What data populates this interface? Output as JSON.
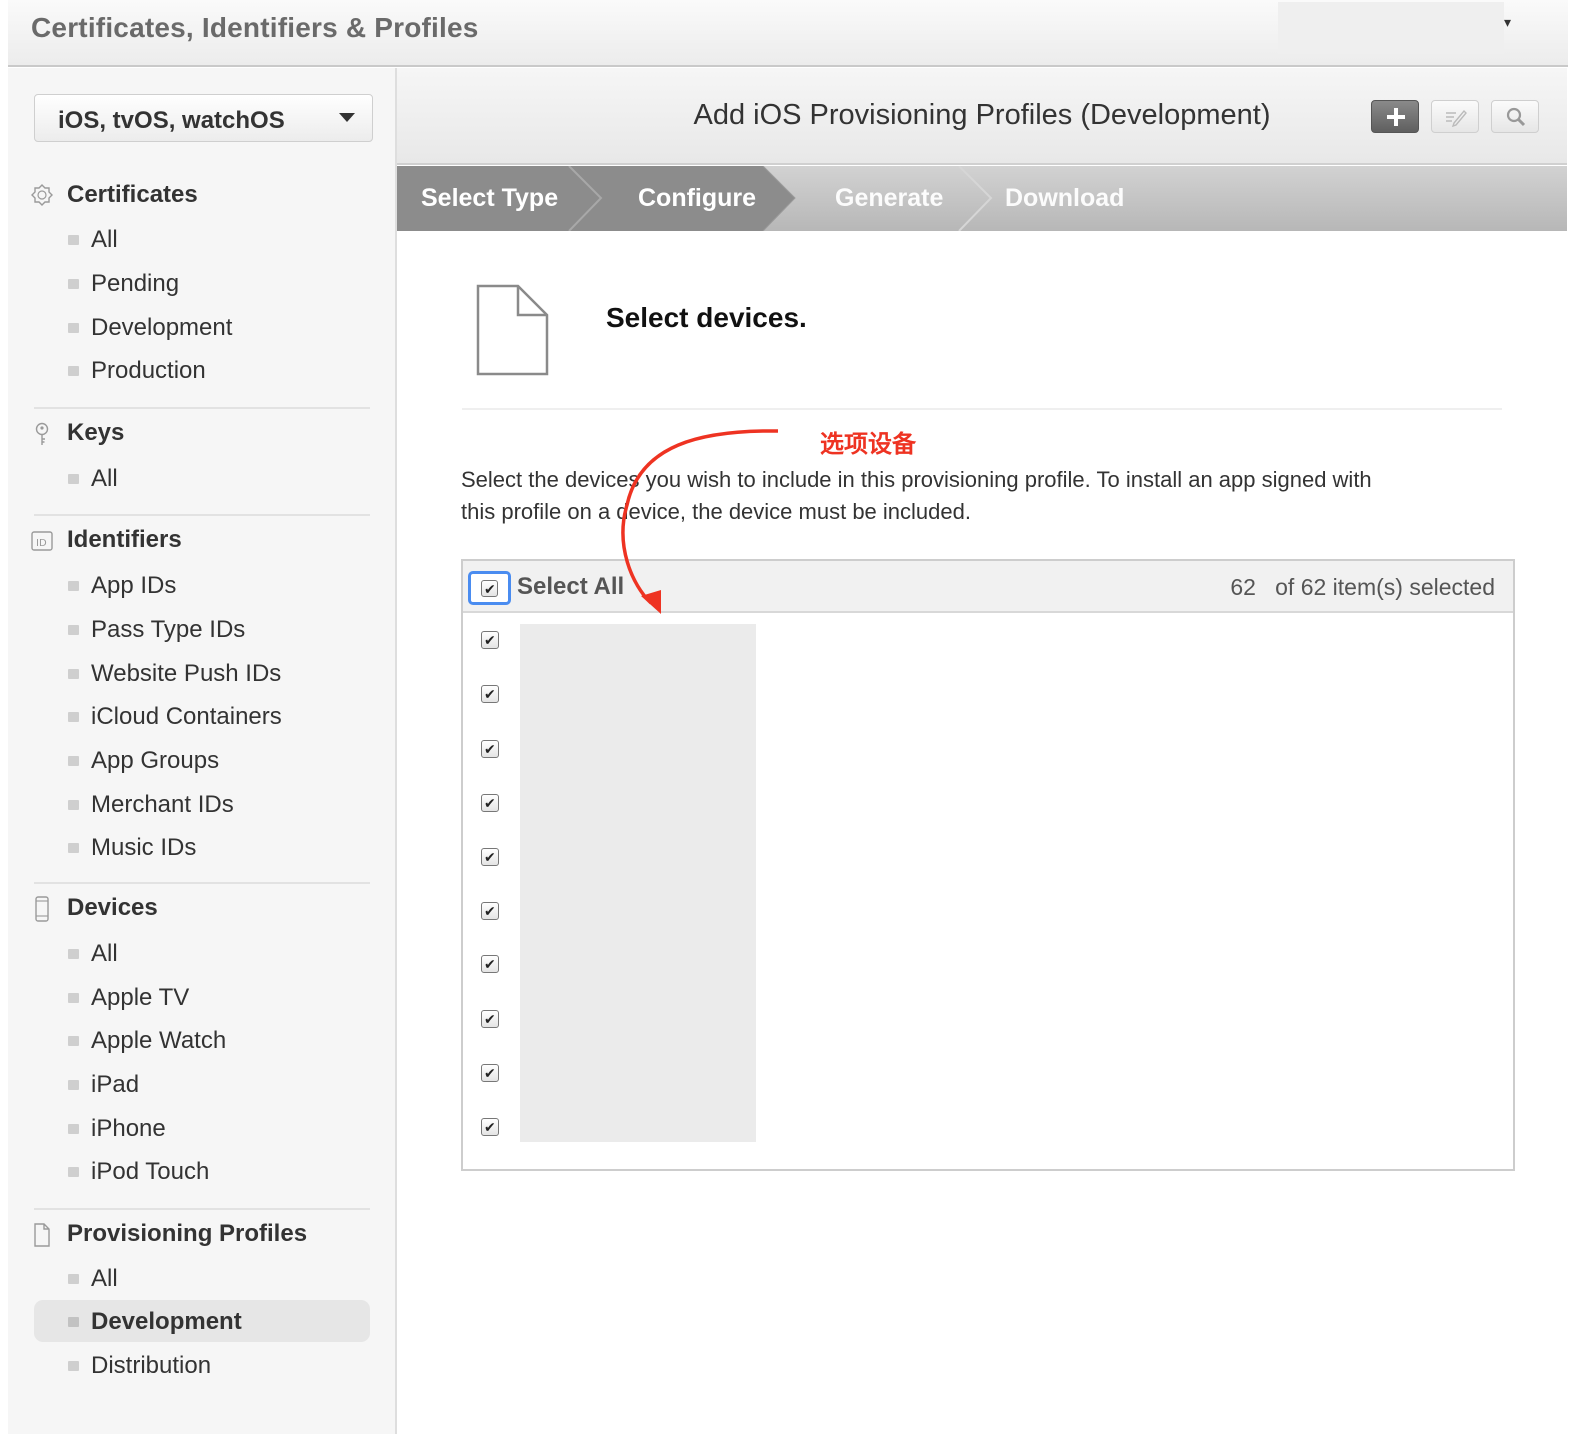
{
  "header": {
    "app_title": "Certificates, Identifiers & Profiles",
    "account_caret": "▾"
  },
  "sidebar": {
    "platform": "iOS, tvOS, watchOS",
    "sections": [
      {
        "title": "Certificates",
        "icon": "certificate-icon",
        "items": [
          "All",
          "Pending",
          "Development",
          "Production"
        ]
      },
      {
        "title": "Keys",
        "icon": "key-icon",
        "items": [
          "All"
        ]
      },
      {
        "title": "Identifiers",
        "icon": "id-badge-icon",
        "items": [
          "App IDs",
          "Pass Type IDs",
          "Website Push IDs",
          "iCloud Containers",
          "App Groups",
          "Merchant IDs",
          "Music IDs"
        ]
      },
      {
        "title": "Devices",
        "icon": "phone-icon",
        "items": [
          "All",
          "Apple TV",
          "Apple Watch",
          "iPad",
          "iPhone",
          "iPod Touch"
        ]
      },
      {
        "title": "Provisioning Profiles",
        "icon": "document-icon",
        "items": [
          "All",
          "Development",
          "Distribution"
        ]
      }
    ],
    "active_item": "Provisioning Profiles / Development"
  },
  "main": {
    "page_title": "Add iOS Provisioning Profiles (Development)",
    "toolbar": {
      "add": "add-icon",
      "edit": "edit-icon",
      "search": "search-icon"
    },
    "steps": [
      "Select Type",
      "Configure",
      "Generate",
      "Download"
    ],
    "current_step": "Configure",
    "step_heading": "Select devices.",
    "annotation": "选项设备",
    "instructions_line1": "Select the devices you wish to include in this provisioning profile. To install an app signed with",
    "instructions_line2": "this profile on a device, the device must be included.",
    "table": {
      "select_all_label": "Select All",
      "selected_count": "62",
      "count_suffix": "of 62 item(s) selected",
      "row_count_visible": 10
    }
  },
  "colors": {
    "annotation": "#ee3322",
    "focus_ring": "#4a8cf0",
    "steps_bar": "#bdbdbd",
    "completed_step": "#8c8c8c"
  }
}
